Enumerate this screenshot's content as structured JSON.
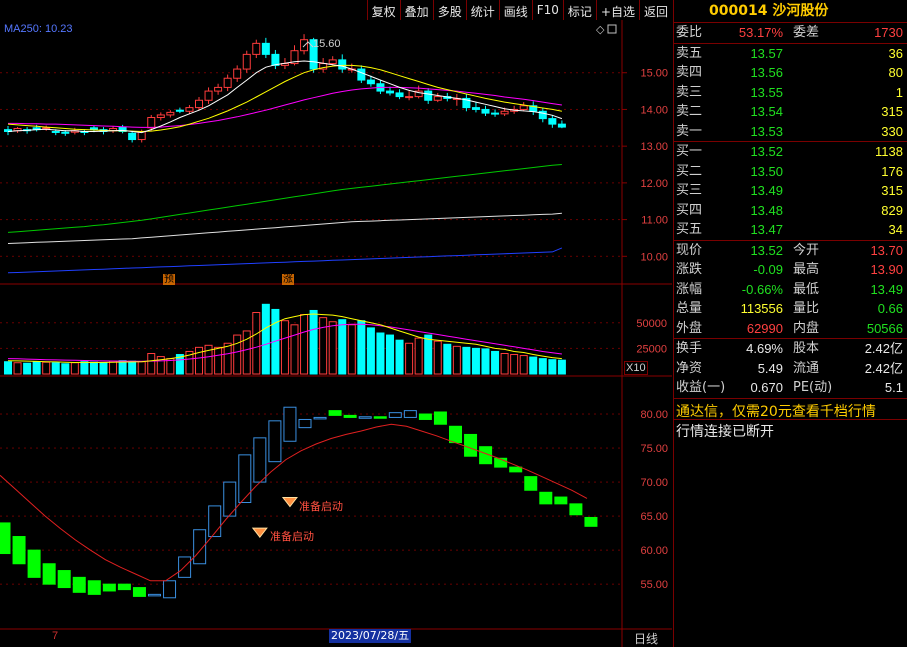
{
  "menu": [
    "复权",
    "叠加",
    "多股",
    "统计",
    "画线",
    "F10",
    "标记",
    "+自选",
    "返回"
  ],
  "colors": {
    "up": "#ff3c3c",
    "down": "#00ffff",
    "ma5": "#ffffff",
    "ma10": "#ffff00",
    "ma20": "#ff00ff",
    "ma60": "#00c800",
    "ma120": "#e0e0e0",
    "ma250": "#2040ff",
    "kdj_up": "#3a8fe0",
    "kdj_down": "#00ff00",
    "signal": "#ff4030"
  },
  "chart": {
    "ma_label": "MA250: 10.23",
    "peak_label": "15.60",
    "markers": [
      "预",
      "涨"
    ],
    "volume_multiplier": "X10",
    "signal_label": "准备启动",
    "date_label": "2023/07/28/五",
    "tick_label": "7",
    "period_label": "日线"
  },
  "chart_data": [
    {
      "type": "candlestick",
      "ylim": [
        9.3,
        16.3
      ],
      "yticks": [
        10.0,
        11.0,
        12.0,
        13.0,
        14.0,
        15.0
      ],
      "open": [
        13.45,
        13.42,
        13.45,
        13.5,
        13.48,
        13.4,
        13.38,
        13.38,
        13.4,
        13.5,
        13.45,
        13.42,
        13.52,
        13.35,
        13.18,
        13.5,
        13.78,
        13.85,
        13.98,
        13.95,
        14.05,
        14.25,
        14.5,
        14.6,
        14.85,
        15.1,
        15.5,
        15.8,
        15.5,
        15.2,
        15.25,
        15.6,
        15.9,
        15.1,
        15.25,
        15.35,
        15.1,
        15.1,
        14.8,
        14.7,
        14.5,
        14.45,
        14.35,
        14.35,
        14.5,
        14.25,
        14.35,
        14.3,
        14.3,
        14.05,
        14.0,
        13.9,
        13.88,
        13.95,
        14.0,
        14.1,
        13.95,
        13.75,
        13.6
      ],
      "close": [
        13.4,
        13.48,
        13.42,
        13.45,
        13.5,
        13.38,
        13.35,
        13.42,
        13.38,
        13.45,
        13.4,
        13.48,
        13.4,
        13.18,
        13.4,
        13.78,
        13.85,
        13.92,
        13.95,
        14.05,
        14.25,
        14.5,
        14.6,
        14.85,
        15.1,
        15.5,
        15.8,
        15.5,
        15.2,
        15.25,
        15.6,
        15.9,
        15.1,
        15.25,
        15.35,
        15.1,
        15.1,
        14.8,
        14.7,
        14.5,
        14.45,
        14.35,
        14.35,
        14.5,
        14.25,
        14.35,
        14.3,
        14.3,
        14.05,
        14.0,
        13.9,
        13.88,
        13.95,
        14.0,
        14.1,
        13.95,
        13.75,
        13.6,
        13.52
      ],
      "high": [
        13.55,
        13.52,
        13.52,
        13.58,
        13.56,
        13.46,
        13.44,
        13.5,
        13.46,
        13.56,
        13.52,
        13.55,
        13.58,
        13.42,
        13.45,
        13.85,
        13.92,
        13.98,
        14.05,
        14.12,
        14.34,
        14.6,
        14.7,
        14.95,
        15.2,
        15.6,
        15.9,
        15.95,
        15.62,
        15.4,
        15.75,
        16.05,
        15.95,
        15.4,
        15.45,
        15.5,
        15.25,
        15.2,
        14.92,
        14.8,
        14.62,
        14.55,
        14.5,
        14.65,
        14.58,
        14.45,
        14.45,
        14.42,
        14.42,
        14.2,
        14.1,
        14.0,
        14.05,
        14.1,
        14.2,
        14.22,
        14.05,
        13.85,
        13.7
      ],
      "low": [
        13.3,
        13.36,
        13.34,
        13.4,
        13.42,
        13.3,
        13.28,
        13.32,
        13.3,
        13.38,
        13.32,
        13.36,
        13.35,
        13.1,
        13.1,
        13.42,
        13.7,
        13.78,
        13.9,
        13.88,
        13.98,
        14.15,
        14.4,
        14.5,
        14.75,
        15.0,
        15.4,
        15.4,
        15.1,
        15.1,
        15.2,
        15.5,
        15.0,
        15.0,
        15.2,
        15.0,
        15.0,
        14.72,
        14.62,
        14.42,
        14.38,
        14.28,
        14.25,
        14.3,
        14.15,
        14.2,
        14.22,
        14.1,
        13.95,
        13.92,
        13.82,
        13.8,
        13.82,
        13.88,
        13.95,
        13.85,
        13.65,
        13.5,
        13.49
      ],
      "ma5": [
        13.4,
        13.42,
        13.43,
        13.45,
        13.46,
        13.44,
        13.42,
        13.42,
        13.4,
        13.4,
        13.41,
        13.42,
        13.43,
        13.4,
        13.37,
        13.45,
        13.55,
        13.66,
        13.78,
        13.88,
        13.98,
        14.1,
        14.25,
        14.4,
        14.6,
        14.8,
        15.0,
        15.15,
        15.22,
        15.26,
        15.3,
        15.32,
        15.3,
        15.26,
        15.22,
        15.18,
        15.1,
        15.0,
        14.9,
        14.8,
        14.7,
        14.6,
        14.52,
        14.46,
        14.42,
        14.38,
        14.34,
        14.3,
        14.26,
        14.2,
        14.14,
        14.08,
        14.02,
        13.98,
        13.96,
        13.94,
        13.9,
        13.84,
        13.75
      ],
      "ma10": [
        13.6,
        13.58,
        13.56,
        13.54,
        13.52,
        13.5,
        13.48,
        13.46,
        13.45,
        13.44,
        13.43,
        13.42,
        13.42,
        13.41,
        13.4,
        13.41,
        13.44,
        13.48,
        13.53,
        13.6,
        13.68,
        13.76,
        13.86,
        13.96,
        14.08,
        14.2,
        14.34,
        14.48,
        14.62,
        14.76,
        14.88,
        15.0,
        15.08,
        15.14,
        15.18,
        15.2,
        15.2,
        15.18,
        15.14,
        15.08,
        15.0,
        14.92,
        14.84,
        14.76,
        14.68,
        14.6,
        14.54,
        14.48,
        14.42,
        14.36,
        14.3,
        14.25,
        14.2,
        14.16,
        14.12,
        14.08,
        14.04,
        14.0,
        13.95
      ],
      "ma20": [
        13.62,
        13.62,
        13.61,
        13.61,
        13.6,
        13.6,
        13.59,
        13.58,
        13.57,
        13.56,
        13.55,
        13.54,
        13.53,
        13.52,
        13.51,
        13.51,
        13.52,
        13.54,
        13.56,
        13.59,
        13.62,
        13.66,
        13.7,
        13.75,
        13.8,
        13.86,
        13.92,
        13.98,
        14.05,
        14.12,
        14.19,
        14.26,
        14.32,
        14.38,
        14.44,
        14.49,
        14.53,
        14.56,
        14.58,
        14.6,
        14.6,
        14.6,
        14.59,
        14.58,
        14.56,
        14.54,
        14.52,
        14.5,
        14.47,
        14.44,
        14.41,
        14.38,
        14.34,
        14.31,
        14.28,
        14.24,
        14.2,
        14.16,
        14.12
      ],
      "ma60": [
        10.65,
        10.67,
        10.69,
        10.71,
        10.73,
        10.75,
        10.77,
        10.79,
        10.81,
        10.84,
        10.86,
        10.89,
        10.92,
        10.95,
        10.98,
        11.02,
        11.06,
        11.1,
        11.14,
        11.18,
        11.22,
        11.26,
        11.3,
        11.34,
        11.38,
        11.42,
        11.46,
        11.5,
        11.54,
        11.58,
        11.62,
        11.66,
        11.7,
        11.74,
        11.78,
        11.82,
        11.85,
        11.88,
        11.91,
        11.94,
        11.97,
        12.0,
        12.03,
        12.06,
        12.09,
        12.12,
        12.15,
        12.18,
        12.21,
        12.24,
        12.27,
        12.3,
        12.33,
        12.36,
        12.39,
        12.42,
        12.45,
        12.48,
        12.5
      ],
      "ma120": [
        10.35,
        10.36,
        10.37,
        10.38,
        10.39,
        10.4,
        10.41,
        10.42,
        10.43,
        10.44,
        10.45,
        10.46,
        10.47,
        10.48,
        10.5,
        10.52,
        10.54,
        10.56,
        10.58,
        10.6,
        10.62,
        10.64,
        10.66,
        10.68,
        10.7,
        10.72,
        10.74,
        10.76,
        10.78,
        10.8,
        10.82,
        10.84,
        10.86,
        10.88,
        10.9,
        10.92,
        10.94,
        10.95,
        10.96,
        10.97,
        10.98,
        10.99,
        11.0,
        11.01,
        11.02,
        11.03,
        11.04,
        11.05,
        11.06,
        11.07,
        11.08,
        11.09,
        11.1,
        11.11,
        11.12,
        11.13,
        11.14,
        11.15,
        11.17
      ],
      "ma250": [
        9.55,
        9.56,
        9.57,
        9.58,
        9.59,
        9.6,
        9.61,
        9.62,
        9.63,
        9.64,
        9.65,
        9.66,
        9.67,
        9.68,
        9.69,
        9.7,
        9.71,
        9.72,
        9.73,
        9.74,
        9.75,
        9.76,
        9.77,
        9.78,
        9.79,
        9.8,
        9.81,
        9.82,
        9.83,
        9.84,
        9.85,
        9.86,
        9.87,
        9.88,
        9.89,
        9.9,
        9.91,
        9.92,
        9.93,
        9.94,
        9.95,
        9.96,
        9.97,
        9.98,
        9.99,
        10.0,
        10.01,
        10.02,
        10.03,
        10.04,
        10.05,
        10.06,
        10.07,
        10.08,
        10.09,
        10.1,
        10.11,
        10.12,
        10.23
      ]
    },
    {
      "type": "bar",
      "ylim": [
        0,
        100000
      ],
      "yticks": [
        25000,
        50000
      ],
      "volume": [
        12000,
        11000,
        10500,
        12000,
        11500,
        11000,
        10000,
        11000,
        12000,
        11500,
        11000,
        12500,
        13000,
        12500,
        12000,
        20000,
        17000,
        15000,
        19000,
        22000,
        26000,
        28000,
        26000,
        30000,
        38000,
        42000,
        60000,
        68000,
        63000,
        52000,
        48000,
        58000,
        62000,
        55000,
        51000,
        53000,
        48000,
        52000,
        45000,
        40000,
        38000,
        33000,
        30000,
        35000,
        38000,
        32000,
        29000,
        27000,
        26000,
        25000,
        24500,
        22000,
        20000,
        19000,
        18000,
        16500,
        15000,
        14000,
        13500
      ],
      "ma1": [
        13000,
        12800,
        12600,
        12300,
        12000,
        11800,
        11500,
        11200,
        11300,
        11200,
        11300,
        11500,
        11700,
        11800,
        12000,
        13000,
        14000,
        15000,
        16500,
        18500,
        21000,
        23000,
        25000,
        27000,
        30000,
        34000,
        39000,
        45000,
        50000,
        54000,
        56000,
        58000,
        58500,
        58000,
        57500,
        56000,
        54000,
        52000,
        50000,
        48000,
        45000,
        42000,
        39000,
        36000,
        34000,
        33000,
        32000,
        31000,
        30000,
        29000,
        27000,
        25000,
        24000,
        22000,
        21000,
        19000,
        17500,
        16000,
        15000
      ],
      "ma2": [
        15000,
        14800,
        14500,
        14200,
        14000,
        13800,
        13600,
        13400,
        13200,
        13000,
        12800,
        12700,
        12600,
        12500,
        12500,
        12600,
        12800,
        13200,
        13800,
        14600,
        15600,
        16800,
        18200,
        19800,
        21600,
        23800,
        26200,
        29000,
        32000,
        35000,
        38000,
        41000,
        43500,
        45500,
        47000,
        48000,
        48500,
        48500,
        48000,
        47000,
        46000,
        44500,
        43000,
        41500,
        40000,
        38500,
        37000,
        35500,
        34000,
        32500,
        31000,
        29500,
        28000,
        26500,
        25000,
        23500,
        22000,
        20800,
        19500
      ]
    },
    {
      "type": "bar",
      "ylim": [
        49,
        85
      ],
      "yticks": [
        55.0,
        60.0,
        65.0,
        70.0,
        75.0,
        80.0
      ],
      "open": [
        64,
        62,
        60,
        58,
        57,
        56,
        55.5,
        55,
        55,
        54.5,
        53.5,
        53,
        56,
        58,
        62,
        65,
        67,
        70,
        73,
        76,
        78,
        79.5,
        80.5,
        79.8,
        79.5,
        79.6,
        79.5,
        79.5,
        80,
        80.3,
        78.2,
        77,
        75.2,
        73.5,
        72.2,
        70.8,
        68.5,
        67.8,
        66.8,
        64.8
      ],
      "close": [
        59.5,
        58,
        56,
        55,
        54.5,
        53.8,
        53.5,
        54,
        54.2,
        53.2,
        53.5,
        55.5,
        59,
        63,
        66.5,
        70,
        74,
        76.5,
        79,
        81,
        79.2,
        79.5,
        79.8,
        79.5,
        79.6,
        79.5,
        80.2,
        80.5,
        79.2,
        78.5,
        75.8,
        73.8,
        72.7,
        72.2,
        71.5,
        68.8,
        66.8,
        66.8,
        65.2,
        63.5
      ],
      "line": [
        71,
        69,
        67,
        65,
        63.2,
        61.5,
        60,
        58.6,
        57.5,
        56.5,
        55.5,
        55.5,
        57,
        59.2,
        61.8,
        64.5,
        67,
        69.4,
        71.5,
        73.3,
        74.6,
        75.6,
        76.4,
        77,
        77.5,
        78.1,
        78.5,
        78.2,
        77.5,
        76.8,
        76,
        75.2,
        74.4,
        73.6,
        72.7,
        71.8,
        70.8,
        69.8,
        68.8,
        67.6
      ],
      "signals": [
        {
          "index": 17,
          "value": 62.5
        },
        {
          "index": 19,
          "value": 67
        }
      ]
    }
  ],
  "quote": {
    "code": "000014",
    "name": "沙河股份",
    "rows_top": [
      {
        "label": "委比",
        "value": "53.17%",
        "value_cls": "up",
        "label2": "委差",
        "value2": "1730",
        "value2_cls": "up"
      }
    ],
    "sell": [
      {
        "label": "卖五",
        "price": "13.57",
        "volume": "36"
      },
      {
        "label": "卖四",
        "price": "13.56",
        "volume": "80"
      },
      {
        "label": "卖三",
        "price": "13.55",
        "volume": "1"
      },
      {
        "label": "卖二",
        "price": "13.54",
        "volume": "315"
      },
      {
        "label": "卖一",
        "price": "13.53",
        "volume": "330"
      }
    ],
    "buy": [
      {
        "label": "买一",
        "price": "13.52",
        "volume": "1138"
      },
      {
        "label": "买二",
        "price": "13.50",
        "volume": "176"
      },
      {
        "label": "买三",
        "price": "13.49",
        "volume": "315"
      },
      {
        "label": "买四",
        "price": "13.48",
        "volume": "829"
      },
      {
        "label": "买五",
        "price": "13.47",
        "volume": "34"
      }
    ],
    "stats1": [
      {
        "label": "现价",
        "value": "13.52",
        "value_cls": "down",
        "label2": "今开",
        "value2": "13.70",
        "value2_cls": "up"
      },
      {
        "label": "涨跌",
        "value": "-0.09",
        "value_cls": "down",
        "label2": "最高",
        "value2": "13.90",
        "value2_cls": "up"
      },
      {
        "label": "涨幅",
        "value": "-0.66%",
        "value_cls": "down",
        "label2": "最低",
        "value2": "13.49",
        "value2_cls": "down"
      },
      {
        "label": "总量",
        "value": "113556",
        "value_cls": "yellow",
        "label2": "量比",
        "value2": "0.66",
        "value2_cls": "down"
      },
      {
        "label": "外盘",
        "value": "62990",
        "value_cls": "up",
        "label2": "内盘",
        "value2": "50566",
        "value2_cls": "down"
      }
    ],
    "stats2": [
      {
        "label": "换手",
        "value": "4.69%",
        "value_cls": "white",
        "label2": "股本",
        "value2": "2.42亿",
        "value2_cls": "white"
      },
      {
        "label": "净资",
        "value": "5.49",
        "value_cls": "white",
        "label2": "流通",
        "value2": "2.42亿",
        "value2_cls": "white"
      },
      {
        "label": "收益(一)",
        "value": "0.670",
        "value_cls": "white",
        "label2": "PE(动)",
        "value2": "5.1",
        "value2_cls": "white"
      }
    ],
    "ad": "通达信，仅需20元查看千档行情",
    "status": "行情连接已断开"
  }
}
